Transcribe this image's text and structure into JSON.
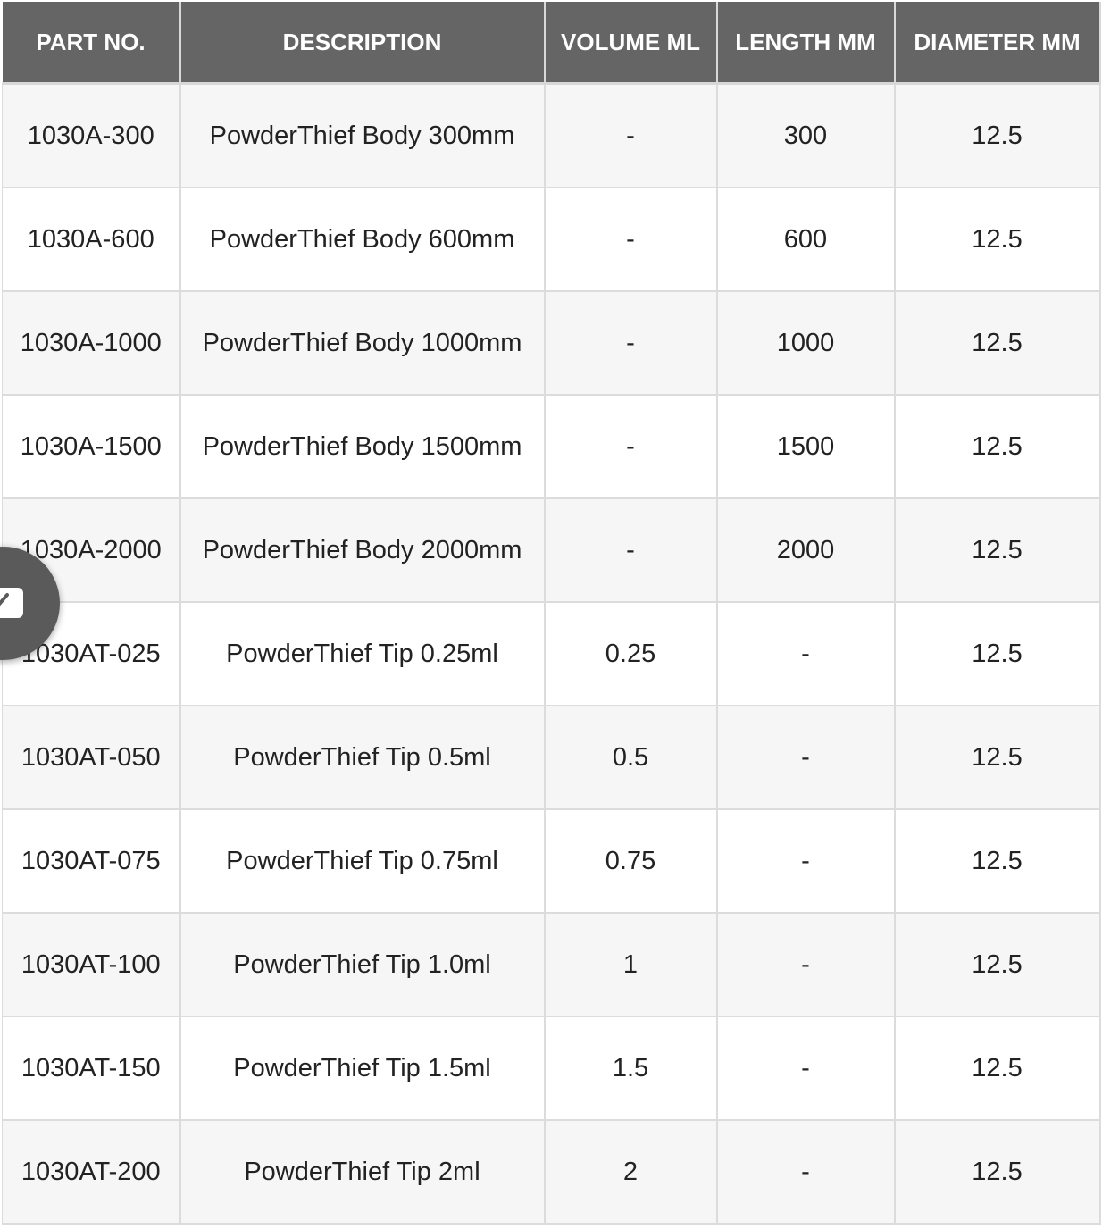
{
  "table": {
    "headers": [
      "PART NO.",
      "DESCRIPTION",
      "VOLUME ML",
      "LENGTH MM",
      "DIAMETER MM"
    ],
    "rows": [
      [
        "1030A-300",
        "PowderThief Body 300mm",
        "-",
        "300",
        "12.5"
      ],
      [
        "1030A-600",
        "PowderThief Body 600mm",
        "-",
        "600",
        "12.5"
      ],
      [
        "1030A-1000",
        "PowderThief Body 1000mm",
        "-",
        "1000",
        "12.5"
      ],
      [
        "1030A-1500",
        "PowderThief Body 1500mm",
        "-",
        "1500",
        "12.5"
      ],
      [
        "1030A-2000",
        "PowderThief Body 2000mm",
        "-",
        "2000",
        "12.5"
      ],
      [
        "1030AT-025",
        "PowderThief Tip 0.25ml",
        "0.25",
        "-",
        "12.5"
      ],
      [
        "1030AT-050",
        "PowderThief Tip 0.5ml",
        "0.5",
        "-",
        "12.5"
      ],
      [
        "1030AT-075",
        "PowderThief Tip 0.75ml",
        "0.75",
        "-",
        "12.5"
      ],
      [
        "1030AT-100",
        "PowderThief Tip 1.0ml",
        "1",
        "-",
        "12.5"
      ],
      [
        "1030AT-150",
        "PowderThief Tip 1.5ml",
        "1.5",
        "-",
        "12.5"
      ],
      [
        "1030AT-200",
        "PowderThief Tip 2ml",
        "2",
        "-",
        "12.5"
      ]
    ]
  },
  "contact_button": {
    "icon": "mail-icon"
  },
  "colors": {
    "header_bg": "#656565",
    "header_text": "#ffffff",
    "row_alt_bg": "#f6f6f6",
    "row_bg": "#ffffff",
    "fab_bg": "#5a5a5a"
  }
}
